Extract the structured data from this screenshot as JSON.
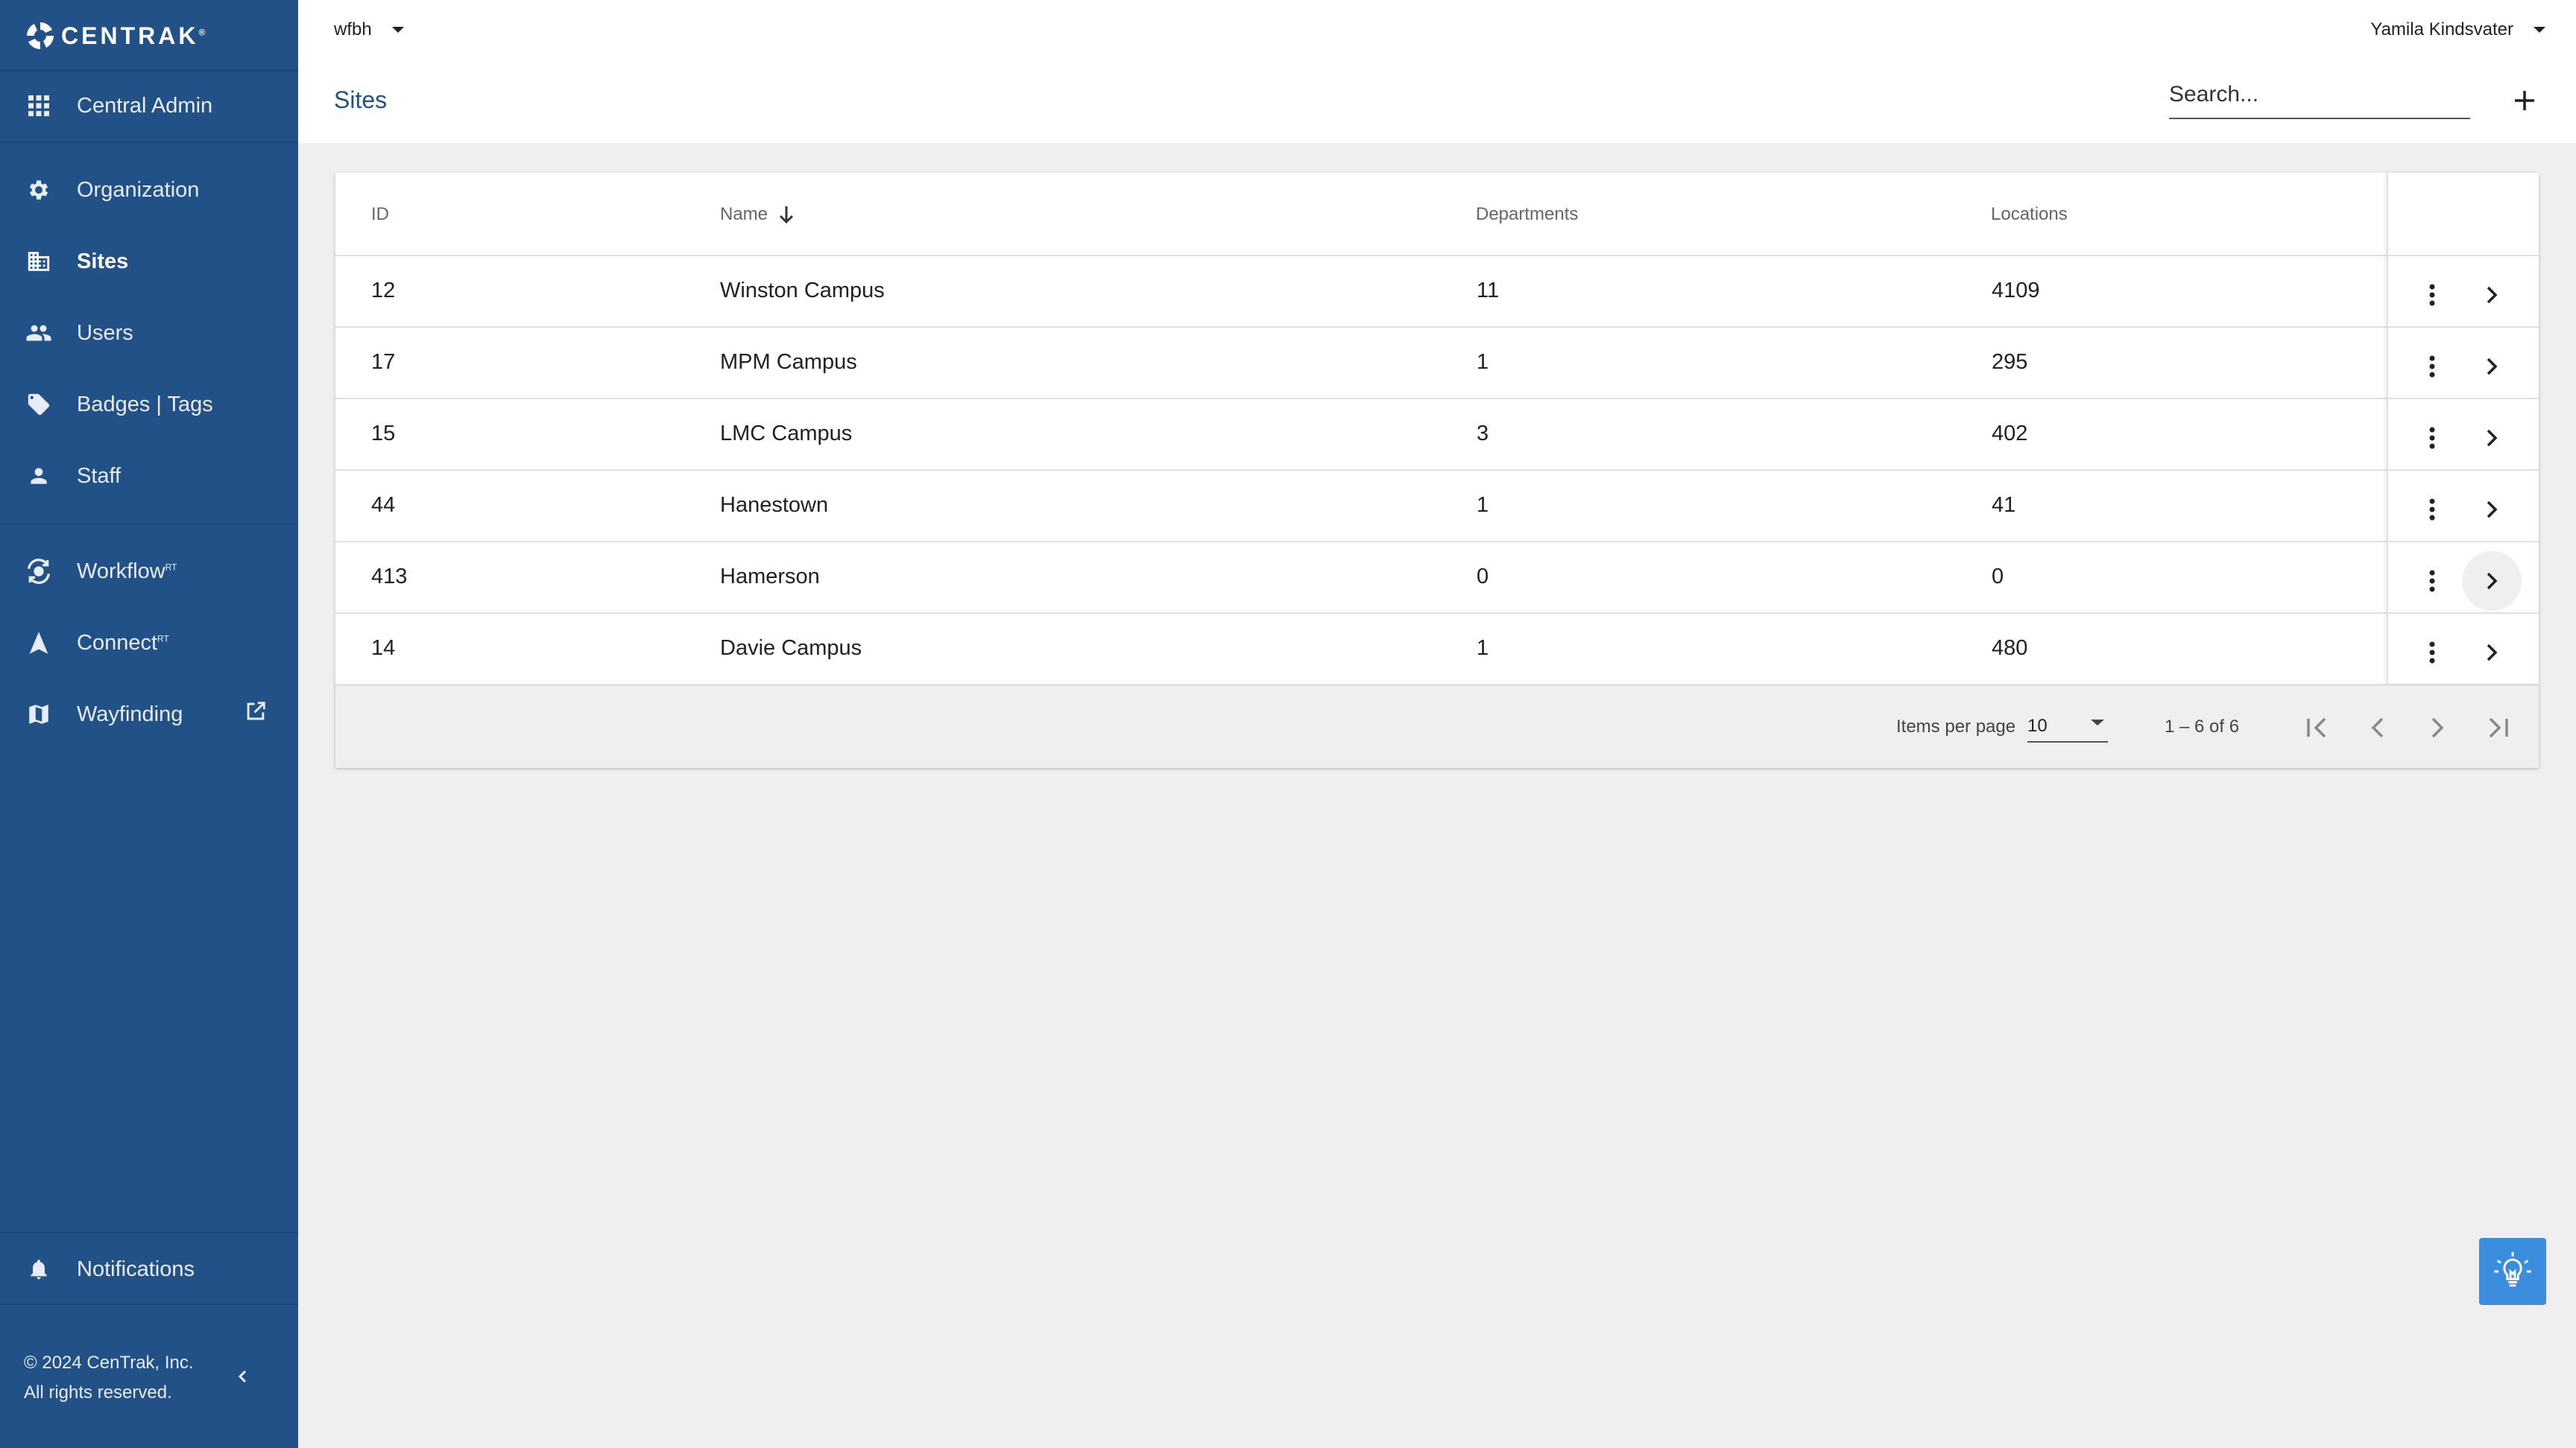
{
  "brand": {
    "logo_text": "CENTRAK",
    "trademark": "®"
  },
  "sidebar": {
    "items": [
      {
        "label": "Central Admin",
        "icon": "apps-grid-icon"
      },
      {
        "label": "Organization",
        "icon": "gear-icon"
      },
      {
        "label": "Sites",
        "icon": "building-icon",
        "active": true
      },
      {
        "label": "Users",
        "icon": "people-icon"
      },
      {
        "label": "Badges | Tags",
        "icon": "tag-icon"
      },
      {
        "label": "Staff",
        "icon": "person-icon"
      },
      {
        "label": "Workflow",
        "sup": "RT",
        "icon": "workflow-icon"
      },
      {
        "label": "Connect",
        "sup": "RT",
        "icon": "connect-icon"
      },
      {
        "label": "Wayfinding",
        "icon": "map-icon"
      }
    ],
    "notifications_label": "Notifications",
    "footer_line1": "© 2024 CenTrak, Inc.",
    "footer_line2": "All rights reserved."
  },
  "header": {
    "tenant": "wfbh",
    "user": "Yamila Kindsvater",
    "page_title": "Sites",
    "search_placeholder": "Search..."
  },
  "table": {
    "columns": [
      "ID",
      "Name",
      "Departments",
      "Locations"
    ],
    "sort": {
      "column": "Name",
      "direction": "desc"
    },
    "rows": [
      {
        "id": "12",
        "name": "Winston Campus",
        "departments": "11",
        "locations": "4109"
      },
      {
        "id": "17",
        "name": "MPM Campus",
        "departments": "1",
        "locations": "295"
      },
      {
        "id": "15",
        "name": "LMC Campus",
        "departments": "3",
        "locations": "402"
      },
      {
        "id": "44",
        "name": "Hanestown",
        "departments": "1",
        "locations": "41"
      },
      {
        "id": "413",
        "name": "Hamerson",
        "departments": "0",
        "locations": "0"
      },
      {
        "id": "14",
        "name": "Davie Campus",
        "departments": "1",
        "locations": "480"
      }
    ]
  },
  "paginator": {
    "items_per_page_label": "Items per page",
    "items_per_page": "10",
    "range": "1 – 6 of 6"
  },
  "colors": {
    "sidebar": "#225188",
    "accent": "#225188",
    "fab": "#3b8edd",
    "background": "#efefef"
  }
}
